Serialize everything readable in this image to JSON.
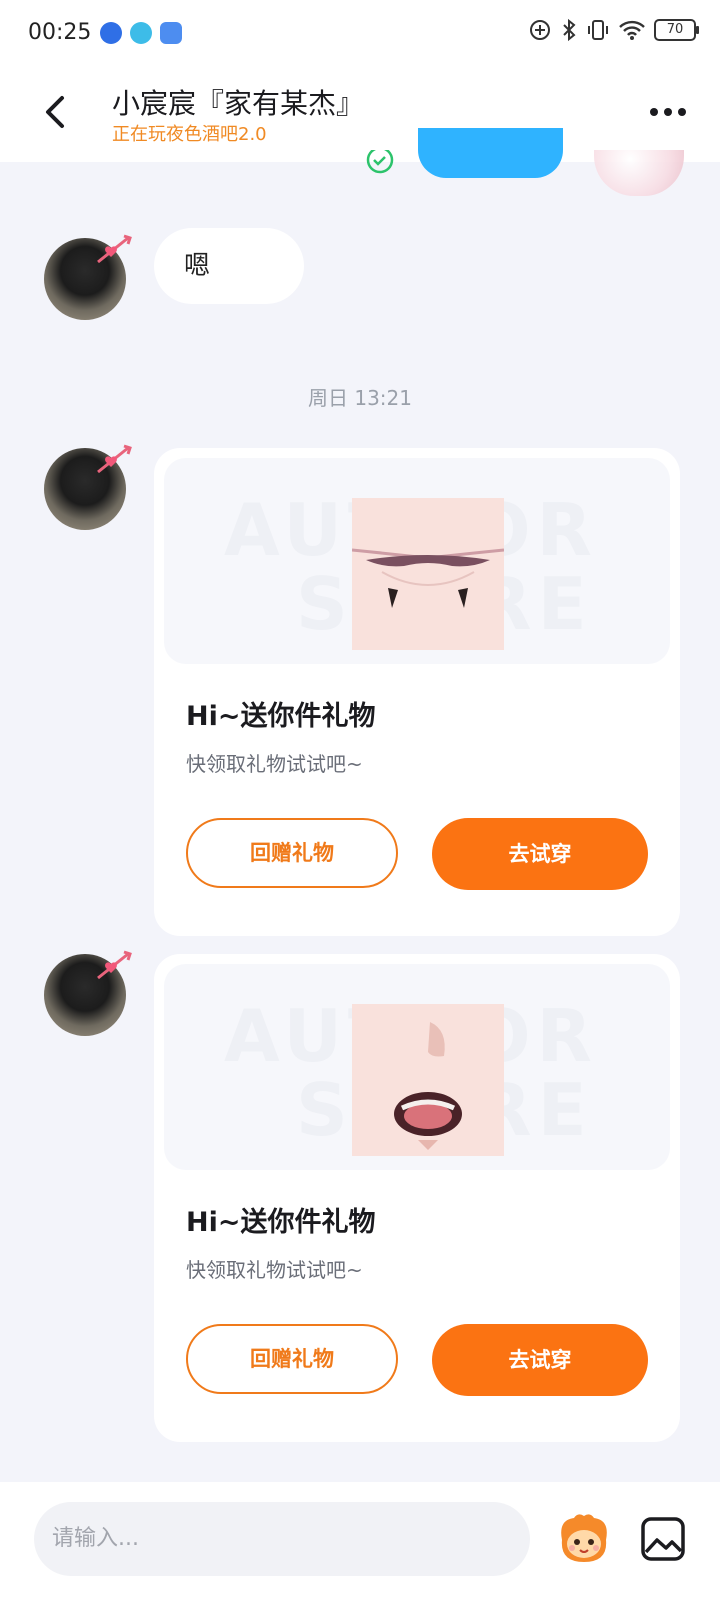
{
  "status_bar": {
    "time": "00:25",
    "battery": "70"
  },
  "header": {
    "title": "小宸宸『家有某杰』",
    "subtitle": "正在玩夜色酒吧2.0"
  },
  "messages": {
    "text_bubble": "嗯",
    "time_separator": "周日 13:21"
  },
  "gift_cards": [
    {
      "title": "Hi~送你件礼物",
      "desc": "快领取礼物试试吧~",
      "return_label": "回赠礼物",
      "try_label": "去试穿",
      "watermark_1": "AUTHOR",
      "watermark_2": "STORE"
    },
    {
      "title": "Hi~送你件礼物",
      "desc": "快领取礼物试试吧~",
      "return_label": "回赠礼物",
      "try_label": "去试穿",
      "watermark_1": "AUTHOR",
      "watermark_2": "STORE"
    }
  ],
  "input": {
    "placeholder": "请输入..."
  },
  "colors": {
    "accent": "#fb7312",
    "subtitle": "#f08a24",
    "background": "#f3f4fa"
  }
}
